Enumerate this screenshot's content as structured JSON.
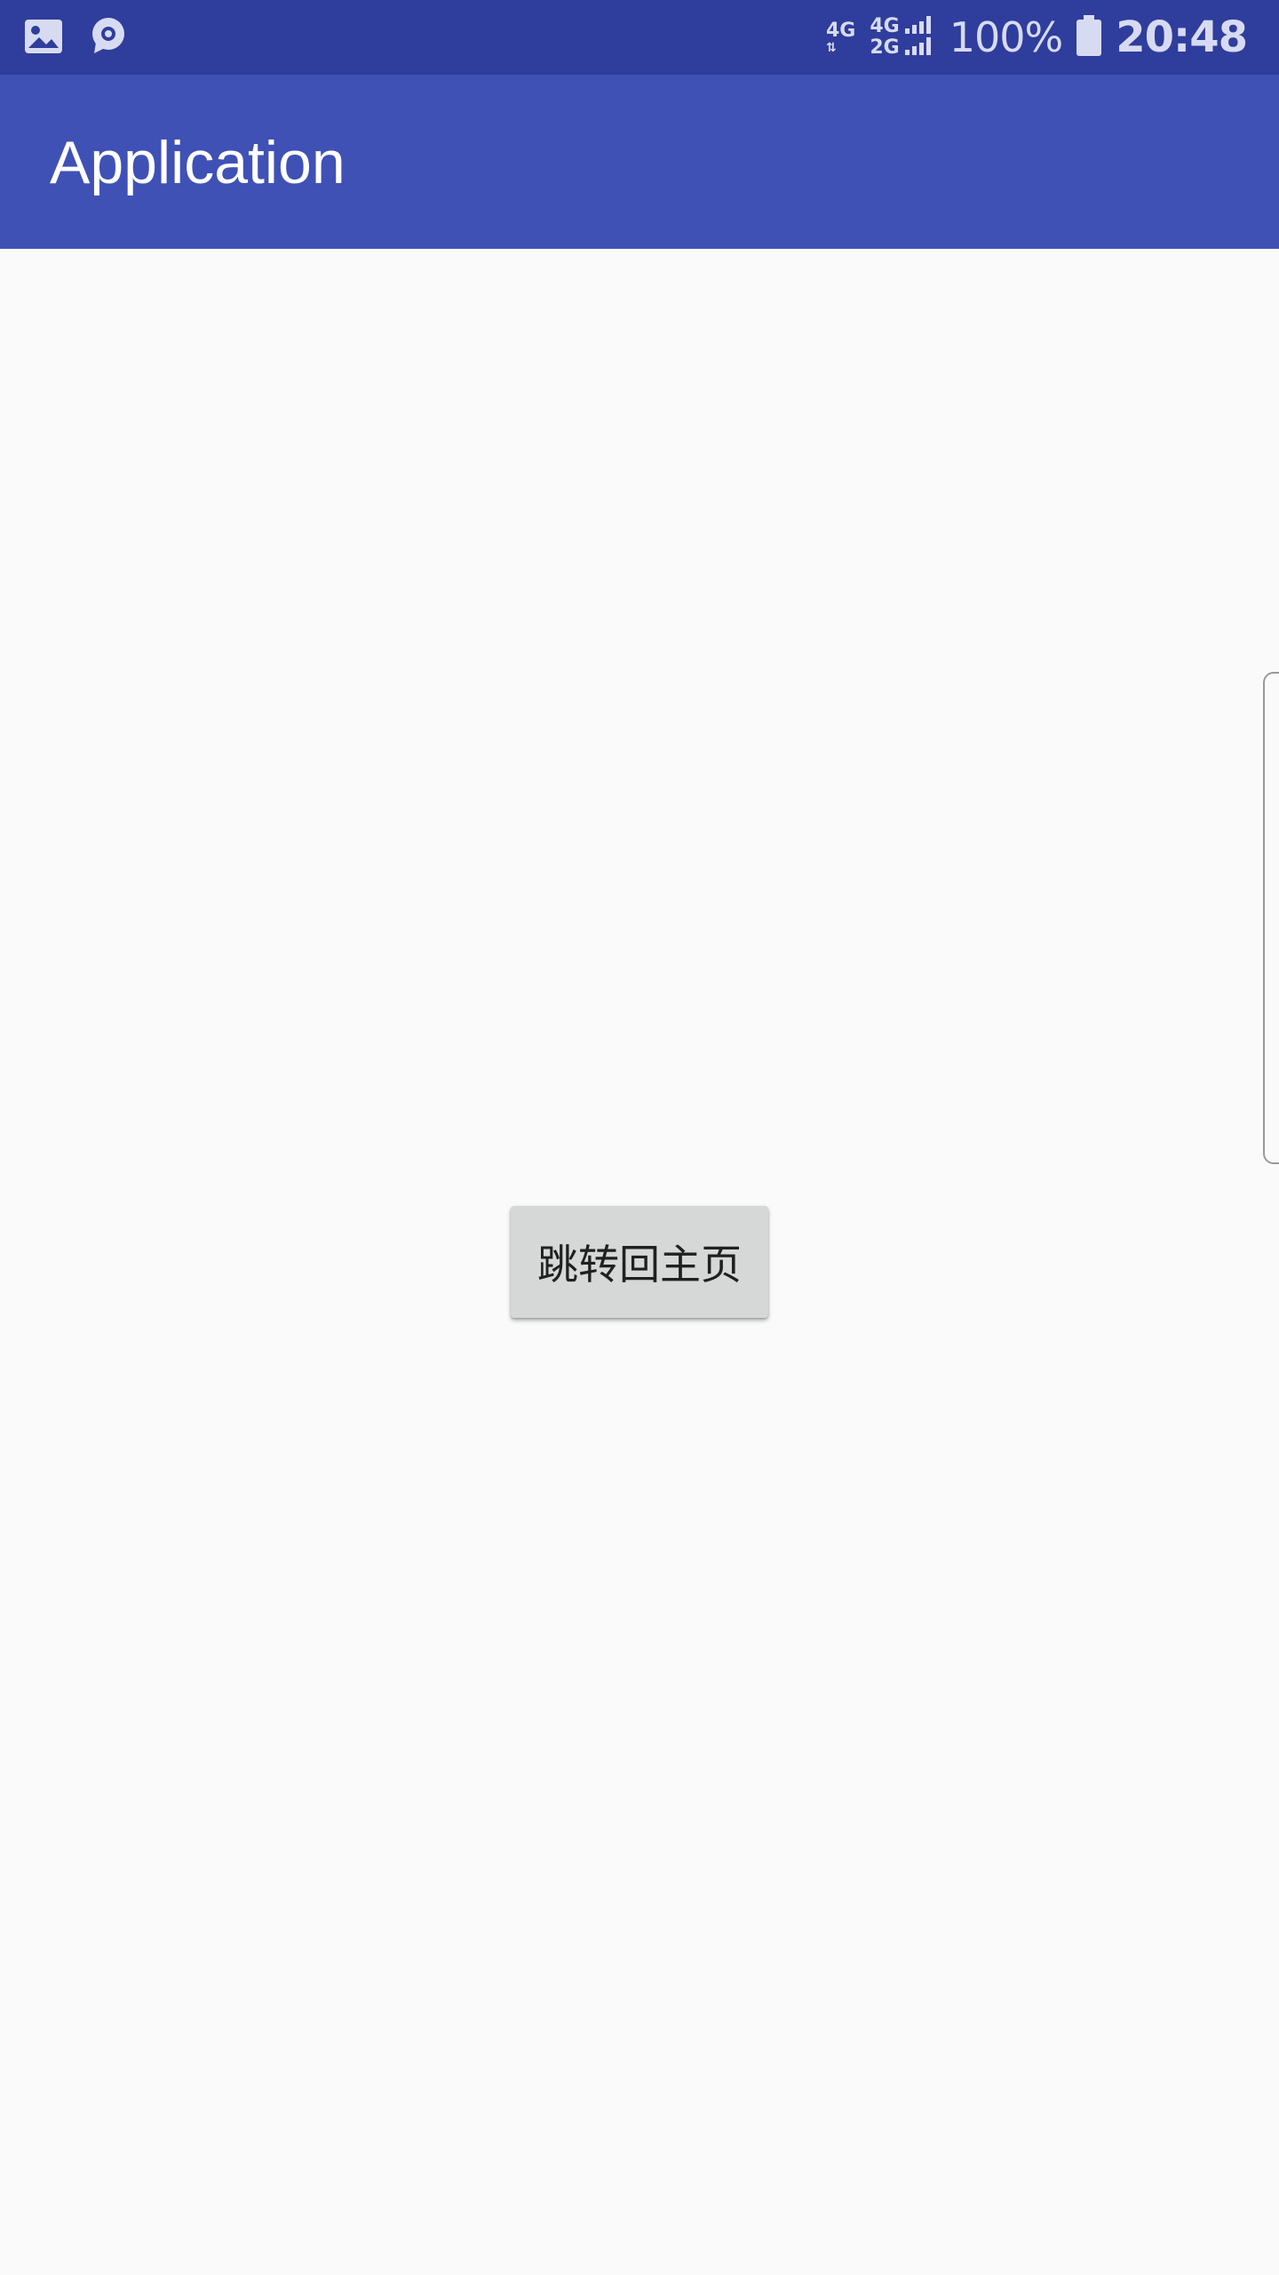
{
  "status_bar": {
    "notification_icons": [
      "image-icon",
      "chat-icon"
    ],
    "network_primary": "4G",
    "network_secondary_top": "4G",
    "network_secondary_bottom": "2G",
    "battery_percent": "100%",
    "time": "20:48"
  },
  "app_bar": {
    "title": "Application"
  },
  "main": {
    "button_label": "跳转回主页"
  },
  "colors": {
    "status_bar": "#2f3d9c",
    "app_bar": "#3f51b5",
    "background": "#fafafa",
    "button": "#d6d7d7"
  }
}
